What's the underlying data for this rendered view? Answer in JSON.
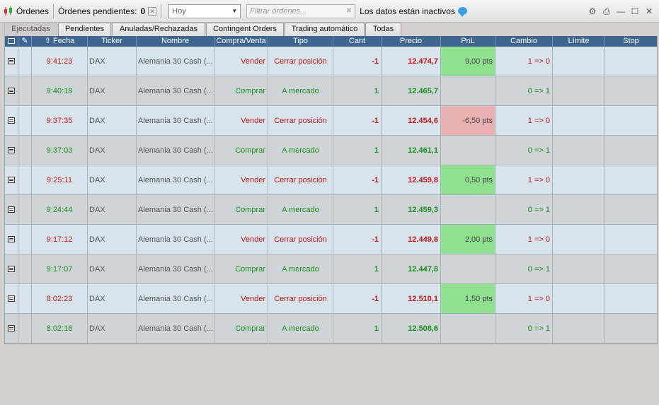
{
  "toolbar": {
    "title": "Órdenes",
    "pending_label": "Órdenes pendientes:",
    "pending_count": "0",
    "date_filter": "Hoy",
    "filter_placeholder": "Filtrar órdenes...",
    "status_text": "Los datos están inactivos"
  },
  "tabs": [
    "Ejecutadas",
    "Pendientes",
    "Anuladas/Rechazadas",
    "Contingent Orders",
    "Trading automático",
    "Todas"
  ],
  "active_tab": "Ejecutadas",
  "columns": [
    "",
    "",
    "Fecha",
    "Ticker",
    "Nombre",
    "Compra/Venta",
    "Tipo",
    "Cant",
    "Precio",
    "PnL",
    "Cambio",
    "Límite",
    "Stop"
  ],
  "colors": {
    "header_bg": "#3f6690",
    "sell": "#c01818",
    "buy": "#1a8f1a",
    "pnl_positive": "#8fe08f",
    "pnl_negative": "#e9b0b0"
  },
  "rows": [
    {
      "time": "9:41:23",
      "ticker": "DAX",
      "name": "Alemania 30 Cash (...",
      "side": "Vender",
      "type": "Cerrar posición",
      "qty": "-1",
      "price": "12.474,7",
      "pnl": "9,00 pts",
      "change": "1 => 0",
      "limit": "",
      "stop": ""
    },
    {
      "time": "9:40:18",
      "ticker": "DAX",
      "name": "Alemania 30 Cash (...",
      "side": "Comprar",
      "type": "A mercado",
      "qty": "1",
      "price": "12.465,7",
      "pnl": "",
      "change": "0 => 1",
      "limit": "",
      "stop": ""
    },
    {
      "time": "9:37:35",
      "ticker": "DAX",
      "name": "Alemania 30 Cash (...",
      "side": "Vender",
      "type": "Cerrar posición",
      "qty": "-1",
      "price": "12.454,6",
      "pnl": "-6,50 pts",
      "change": "1 => 0",
      "limit": "",
      "stop": ""
    },
    {
      "time": "9:37:03",
      "ticker": "DAX",
      "name": "Alemania 30 Cash (...",
      "side": "Comprar",
      "type": "A mercado",
      "qty": "1",
      "price": "12.461,1",
      "pnl": "",
      "change": "0 => 1",
      "limit": "",
      "stop": ""
    },
    {
      "time": "9:25:11",
      "ticker": "DAX",
      "name": "Alemania 30 Cash (...",
      "side": "Vender",
      "type": "Cerrar posición",
      "qty": "-1",
      "price": "12.459,8",
      "pnl": "0,50 pts",
      "change": "1 => 0",
      "limit": "",
      "stop": ""
    },
    {
      "time": "9:24:44",
      "ticker": "DAX",
      "name": "Alemania 30 Cash (...",
      "side": "Comprar",
      "type": "A mercado",
      "qty": "1",
      "price": "12.459,3",
      "pnl": "",
      "change": "0 => 1",
      "limit": "",
      "stop": ""
    },
    {
      "time": "9:17:12",
      "ticker": "DAX",
      "name": "Alemania 30 Cash (...",
      "side": "Vender",
      "type": "Cerrar posición",
      "qty": "-1",
      "price": "12.449,8",
      "pnl": "2,00 pts",
      "change": "1 => 0",
      "limit": "",
      "stop": ""
    },
    {
      "time": "9:17:07",
      "ticker": "DAX",
      "name": "Alemania 30 Cash (...",
      "side": "Comprar",
      "type": "A mercado",
      "qty": "1",
      "price": "12.447,8",
      "pnl": "",
      "change": "0 => 1",
      "limit": "",
      "stop": ""
    },
    {
      "time": "8:02:23",
      "ticker": "DAX",
      "name": "Alemania 30 Cash (...",
      "side": "Vender",
      "type": "Cerrar posición",
      "qty": "-1",
      "price": "12.510,1",
      "pnl": "1,50 pts",
      "change": "1 => 0",
      "limit": "",
      "stop": ""
    },
    {
      "time": "8:02:16",
      "ticker": "DAX",
      "name": "Alemania 30 Cash (...",
      "side": "Comprar",
      "type": "A mercado",
      "qty": "1",
      "price": "12.508,6",
      "pnl": "",
      "change": "0 => 1",
      "limit": "",
      "stop": ""
    }
  ]
}
